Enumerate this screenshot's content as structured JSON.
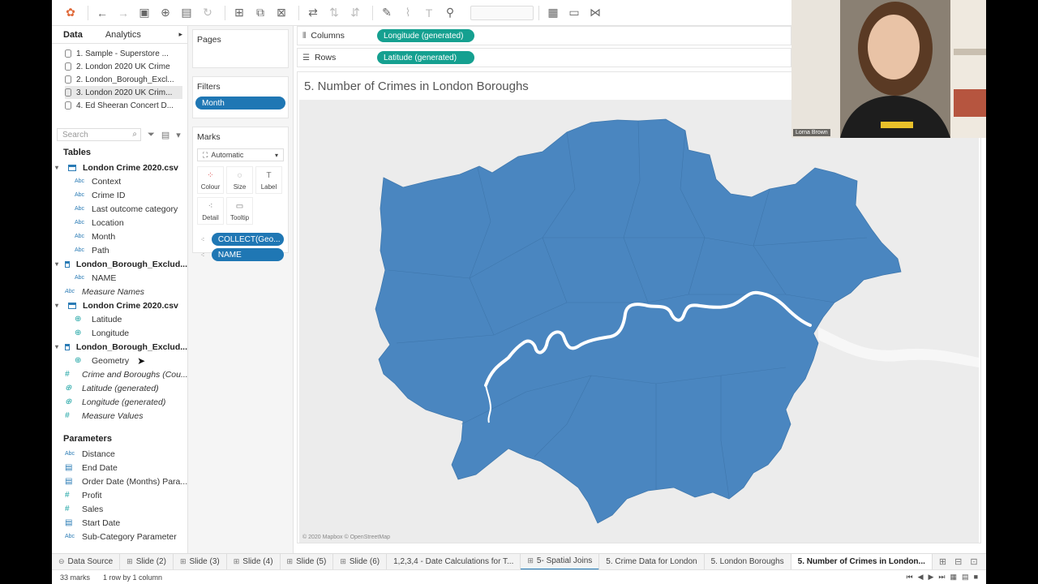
{
  "left_tabs": {
    "data": "Data",
    "analytics": "Analytics"
  },
  "datasources": [
    "1. Sample - Superstore ...",
    "2. London 2020 UK Crime",
    "2. London_Borough_Excl...",
    "3. London 2020 UK Crim...",
    "4. Ed Sheeran Concert D..."
  ],
  "search": {
    "placeholder": "Search"
  },
  "tables_heading": "Tables",
  "tables": [
    {
      "name": "London Crime 2020.csv",
      "fields": [
        "Context",
        "Crime ID",
        "Last outcome category",
        "Location",
        "Month",
        "Path"
      ]
    },
    {
      "name": "London_Borough_Exclud...",
      "fields": [
        "NAME"
      ]
    }
  ],
  "measure_names": "Measure Names",
  "tables2": [
    {
      "name": "London Crime 2020.csv",
      "fields": [
        "Latitude",
        "Longitude"
      ]
    },
    {
      "name": "London_Borough_Exclud...",
      "fields": [
        "Geometry"
      ]
    }
  ],
  "top_fields": [
    "Crime and Boroughs (Cou...",
    "Latitude (generated)",
    "Longitude (generated)",
    "Measure Values"
  ],
  "parameters_heading": "Parameters",
  "parameters": [
    "Distance",
    "End Date",
    "Order Date (Months) Para...",
    "Profit",
    "Sales",
    "Start Date",
    "Sub-Category Parameter"
  ],
  "cards": {
    "pages": "Pages",
    "filters": "Filters",
    "filter_pill": "Month",
    "marks": "Marks",
    "mark_type": "Automatic",
    "mark_buttons": [
      "Colour",
      "Size",
      "Label",
      "Detail",
      "Tooltip"
    ],
    "mark_pills": [
      "COLLECT(Geo...",
      "NAME"
    ]
  },
  "shelves": {
    "columns_label": "Columns",
    "columns_pill": "Longitude (generated)",
    "rows_label": "Rows",
    "rows_pill": "Latitude (generated)"
  },
  "viz": {
    "title": "5. Number of Crimes in London Boroughs",
    "attribution": "© 2020 Mapbox © OpenStreetMap"
  },
  "bottom_tabs": [
    "Data Source",
    "Slide (2)",
    "Slide (3)",
    "Slide (4)",
    "Slide (5)",
    "Slide (6)",
    "1,2,3,4 - Date Calculations for T...",
    "5- Spatial Joins",
    "5. Crime Data for London",
    "5. London Boroughs",
    "5. Number of Crimes in London..."
  ],
  "status": {
    "marks": "33 marks",
    "dims": "1 row by 1 column"
  },
  "webcam": {
    "name": "Lorna Brown"
  },
  "colors": {
    "map_fill": "#4a86c0",
    "river": "#ffffff",
    "pill_blue": "#1f77b4",
    "pill_green": "#15a090"
  }
}
